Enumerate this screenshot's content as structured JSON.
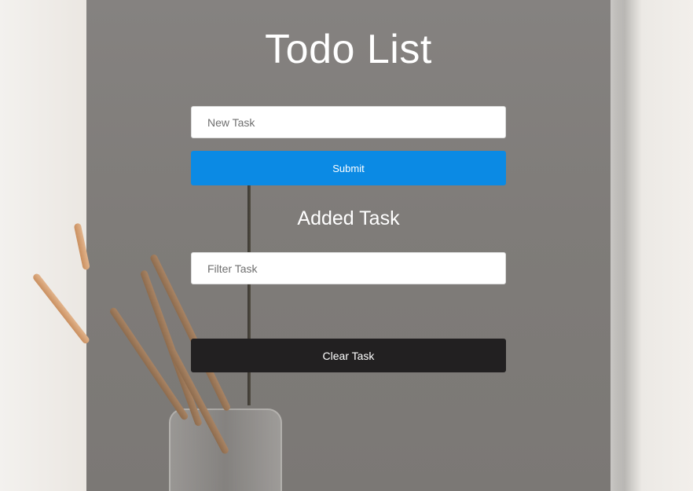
{
  "app": {
    "title": "Todo List"
  },
  "form": {
    "task_placeholder": "New Task",
    "task_value": "",
    "submit_label": "Submit"
  },
  "tasks": {
    "heading": "Added Task",
    "filter_placeholder": "Filter Task",
    "filter_value": "",
    "items": [],
    "clear_label": "Clear Task"
  },
  "colors": {
    "submit_button": "#0b8ae4",
    "clear_button": "#222021",
    "text_on_dark": "#ffffff"
  }
}
